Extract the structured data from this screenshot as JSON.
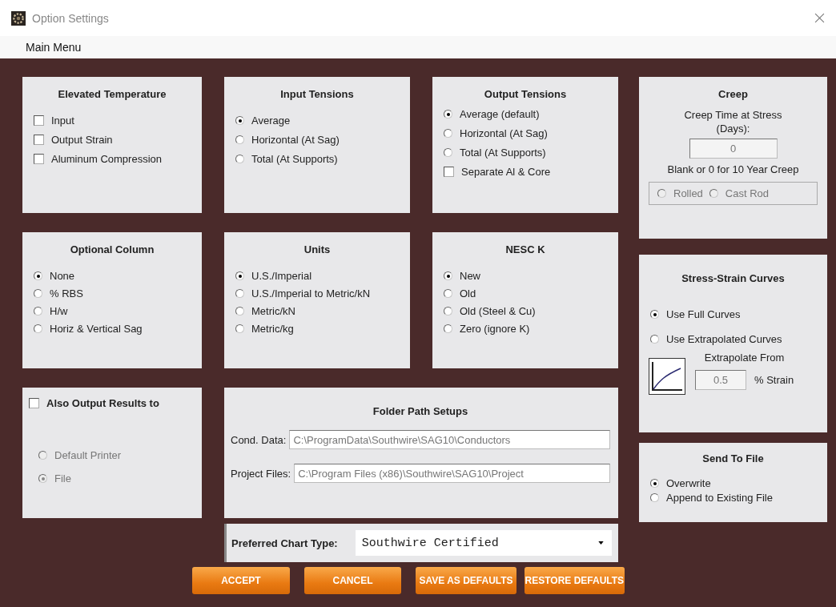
{
  "window": {
    "title": "Option Settings"
  },
  "menu_bar": {
    "items": [
      "Main Menu"
    ]
  },
  "elevated_temperature": {
    "title": "Elevated Temperature",
    "options": [
      {
        "label": "Input",
        "checked": false
      },
      {
        "label": "Output Strain",
        "checked": false
      },
      {
        "label": "Aluminum Compression",
        "checked": false
      }
    ]
  },
  "input_tensions": {
    "title": "Input Tensions",
    "options": [
      {
        "label": "Average",
        "selected": true
      },
      {
        "label": "Horizontal (At Sag)",
        "selected": false
      },
      {
        "label": "Total (At Supports)",
        "selected": false
      }
    ]
  },
  "output_tensions": {
    "title": "Output Tensions",
    "options": [
      {
        "label": "Average (default)",
        "selected": true
      },
      {
        "label": "Horizontal (At Sag)",
        "selected": false
      },
      {
        "label": "Total (At Supports)",
        "selected": false
      }
    ],
    "separate": {
      "label": "Separate Al & Core",
      "checked": false
    }
  },
  "creep": {
    "title": "Creep",
    "prompt": "Creep Time at Stress (Days):",
    "value": "0",
    "note": "Blank or 0  for 10 Year Creep",
    "disabled": true,
    "rod_types": [
      {
        "label": "Rolled",
        "selected": false
      },
      {
        "label": "Cast Rod",
        "selected": false
      }
    ]
  },
  "optional_column": {
    "title": "Optional Column",
    "options": [
      {
        "label": "None",
        "selected": true
      },
      {
        "label": "% RBS",
        "selected": false
      },
      {
        "label": "H/w",
        "selected": false
      },
      {
        "label": "Horiz & Vertical Sag",
        "selected": false
      }
    ]
  },
  "units": {
    "title": "Units",
    "options": [
      {
        "label": "U.S./Imperial",
        "selected": true
      },
      {
        "label": "U.S./Imperial to Metric/kN",
        "selected": false
      },
      {
        "label": "Metric/kN",
        "selected": false
      },
      {
        "label": "Metric/kg",
        "selected": false
      }
    ]
  },
  "nesc_k": {
    "title": "NESC K",
    "options": [
      {
        "label": "New",
        "selected": true
      },
      {
        "label": "Old",
        "selected": false
      },
      {
        "label": "Old (Steel & Cu)",
        "selected": false
      },
      {
        "label": "Zero (ignore K)",
        "selected": false
      }
    ]
  },
  "stress_strain_curves": {
    "title": "Stress-Strain Curves",
    "options": [
      {
        "label": "Use Full Curves",
        "selected": true
      },
      {
        "label": "Use Extrapolated Curves",
        "selected": false
      }
    ],
    "extrapolate_label": "Extrapolate From",
    "extrapolate_value": "0.5",
    "extrapolate_unit": "% Strain"
  },
  "also_output": {
    "label": "Also Output Results to",
    "checked": false,
    "disabled": true,
    "options": [
      {
        "label": "Default Printer",
        "selected": false
      },
      {
        "label": "File",
        "selected": true
      }
    ]
  },
  "folder_paths": {
    "title": "Folder Path Setups",
    "fields": [
      {
        "label": "Cond. Data:",
        "value": "C:\\ProgramData\\Southwire\\SAG10\\Conductors"
      },
      {
        "label": "Project Files:",
        "value": "C:\\Program Files (x86)\\Southwire\\SAG10\\Project"
      }
    ]
  },
  "send_to_file": {
    "title": "Send To File",
    "options": [
      {
        "label": "Overwrite",
        "selected": true
      },
      {
        "label": "Append to Existing File",
        "selected": false
      }
    ]
  },
  "chart_type": {
    "label": "Preferred Chart Type:",
    "value": "Southwire Certified"
  },
  "buttons": [
    "ACCEPT",
    "CANCEL",
    "SAVE AS DEFAULTS",
    "RESTORE DEFAULTS"
  ]
}
